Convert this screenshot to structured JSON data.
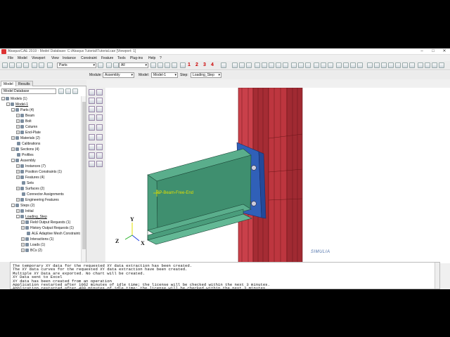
{
  "window": {
    "title": "Abaqus/CAE 2019 - Model Database: C:\\Abaqus Tutorial\\Tutorial.cae [Viewport: 1]",
    "controls": [
      "–",
      "□",
      "✕"
    ]
  },
  "menu": [
    "File",
    "Model",
    "Viewport",
    "View",
    "Instance",
    "Constraint",
    "Feature",
    "Tools",
    "Plug-ins",
    "Help",
    "?"
  ],
  "toolbar": {
    "parts_select": "Parts",
    "filter_select": "All",
    "numbers": [
      "1",
      "2",
      "3",
      "4"
    ]
  },
  "context_bar": {
    "module_label": "Module:",
    "module_value": "Assembly",
    "model_label": "Model:",
    "model_value": "Model-1",
    "step_label": "Step:",
    "step_value": "Loading_Step"
  },
  "tabs": [
    "Model",
    "Results"
  ],
  "tree_select": "Model Database",
  "tree": [
    {
      "label": "Models (1)",
      "indent": 0,
      "exp": "–"
    },
    {
      "label": "Model-1",
      "indent": 1,
      "exp": "–"
    },
    {
      "label": "Parts (4)",
      "indent": 2,
      "exp": "–"
    },
    {
      "label": "Beam",
      "indent": 3,
      "exp": "+"
    },
    {
      "label": "Bolt",
      "indent": 3,
      "exp": "+"
    },
    {
      "label": "Column",
      "indent": 3,
      "exp": "+"
    },
    {
      "label": "End-Plate",
      "indent": 3,
      "exp": "+"
    },
    {
      "label": "Materials (2)",
      "indent": 2,
      "exp": "+"
    },
    {
      "label": "Calibrations",
      "indent": 2,
      "exp": ""
    },
    {
      "label": "Sections (4)",
      "indent": 2,
      "exp": "+"
    },
    {
      "label": "Profiles",
      "indent": 2,
      "exp": ""
    },
    {
      "label": "Assembly",
      "indent": 2,
      "exp": "–"
    },
    {
      "label": "Instances (7)",
      "indent": 3,
      "exp": "+"
    },
    {
      "label": "Position Constraints (1)",
      "indent": 3,
      "exp": "+"
    },
    {
      "label": "Features (4)",
      "indent": 3,
      "exp": "+"
    },
    {
      "label": "Sets",
      "indent": 3,
      "exp": ""
    },
    {
      "label": "Surfaces (2)",
      "indent": 3,
      "exp": "+"
    },
    {
      "label": "Connector Assignments",
      "indent": 3,
      "exp": ""
    },
    {
      "label": "Engineering Features",
      "indent": 3,
      "exp": "+"
    },
    {
      "label": "Steps (2)",
      "indent": 2,
      "exp": "–"
    },
    {
      "label": "Initial",
      "indent": 3,
      "exp": "+"
    },
    {
      "label": "Loading_Step",
      "indent": 3,
      "exp": "–"
    },
    {
      "label": "Field Output Requests (1)",
      "indent": 4,
      "exp": "+"
    },
    {
      "label": "History Output Requests (1)",
      "indent": 4,
      "exp": "+"
    },
    {
      "label": "ALE Adaptive Mesh Constraints",
      "indent": 4,
      "exp": ""
    },
    {
      "label": "Interactions (1)",
      "indent": 4,
      "exp": "+"
    },
    {
      "label": "Loads (1)",
      "indent": 4,
      "exp": "+"
    },
    {
      "label": "BCs (2)",
      "indent": 4,
      "exp": "+"
    }
  ],
  "viewport": {
    "rp_label": "RP-Beam-Free-End",
    "axis_y": "Y",
    "axis_x": "X",
    "axis_z": "Z",
    "brand": "SIMULIA"
  },
  "messages": [
    "The temporary XY data for the requested XY data extraction has been created.",
    "The XY data curves for the requested XY data extraction have been created.",
    "Multiple XY Data are exported. No chart will be created.",
    "XY Data sent to Excel",
    "XY data has been created from an operation",
    "Application restarted after 1062 minutes of idle time; the license will be checked within the next 3 minutes.",
    "Application restarted after 400 minutes of idle time; the license will be checked within the next 3 minutes."
  ],
  "colors": {
    "column": "#b8323a",
    "beam": "#4e9c7c",
    "endplate": "#3d6fc4",
    "accent_numbers": "#cc0000"
  }
}
